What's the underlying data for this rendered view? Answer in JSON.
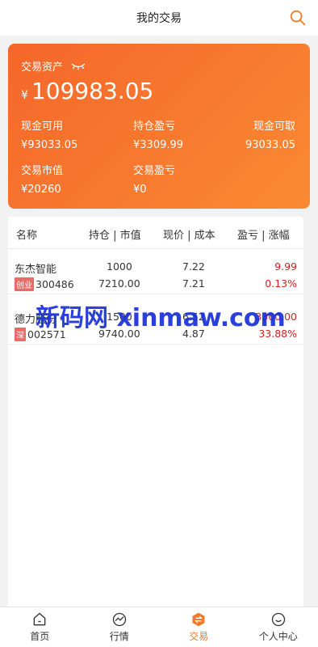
{
  "header": {
    "title": "我的交易",
    "search_icon": "search-icon"
  },
  "card": {
    "asset_label": "交易资产",
    "currency": "¥",
    "asset_value": "109983.05",
    "stats": {
      "cash_available_label": "现金可用",
      "cash_available_value": "¥93033.05",
      "position_pl_label": "持仓盈亏",
      "position_pl_value": "¥3309.99",
      "cash_withdrawable_label": "现金可取",
      "cash_withdrawable_value": "93033.05",
      "market_value_label": "交易市值",
      "market_value_value": "¥20260",
      "trade_pl_label": "交易盈亏",
      "trade_pl_value": "¥0"
    },
    "colors": {
      "gradient_start": "#f5662a",
      "gradient_end": "#f98a33"
    }
  },
  "table": {
    "headers": [
      "名称",
      "持仓 | 市值",
      "现价 | 成本",
      "盈亏 | 涨幅"
    ],
    "rows": [
      {
        "name": "东杰智能",
        "tag": "创业",
        "code": "300486",
        "position": "1000",
        "market_value": "7210.00",
        "price": "7.22",
        "cost": "7.21",
        "pl": "9.99",
        "change": "0.13%"
      },
      {
        "name": "德力股份",
        "tag": "深",
        "code": "002571",
        "position": "1500",
        "market_value": "9740.00",
        "price": "6.52",
        "cost": "4.87",
        "pl": "3300.00",
        "change": "33.88%"
      }
    ]
  },
  "watermark": "新码网 xinmaw.com",
  "tabs": [
    {
      "label": "首页",
      "icon": "home-icon"
    },
    {
      "label": "行情",
      "icon": "chart-icon"
    },
    {
      "label": "交易",
      "icon": "exchange-icon",
      "active": true
    },
    {
      "label": "个人中心",
      "icon": "user-icon"
    }
  ],
  "accent_color": "#f07a2a",
  "loss_profit_color": "#d42020"
}
